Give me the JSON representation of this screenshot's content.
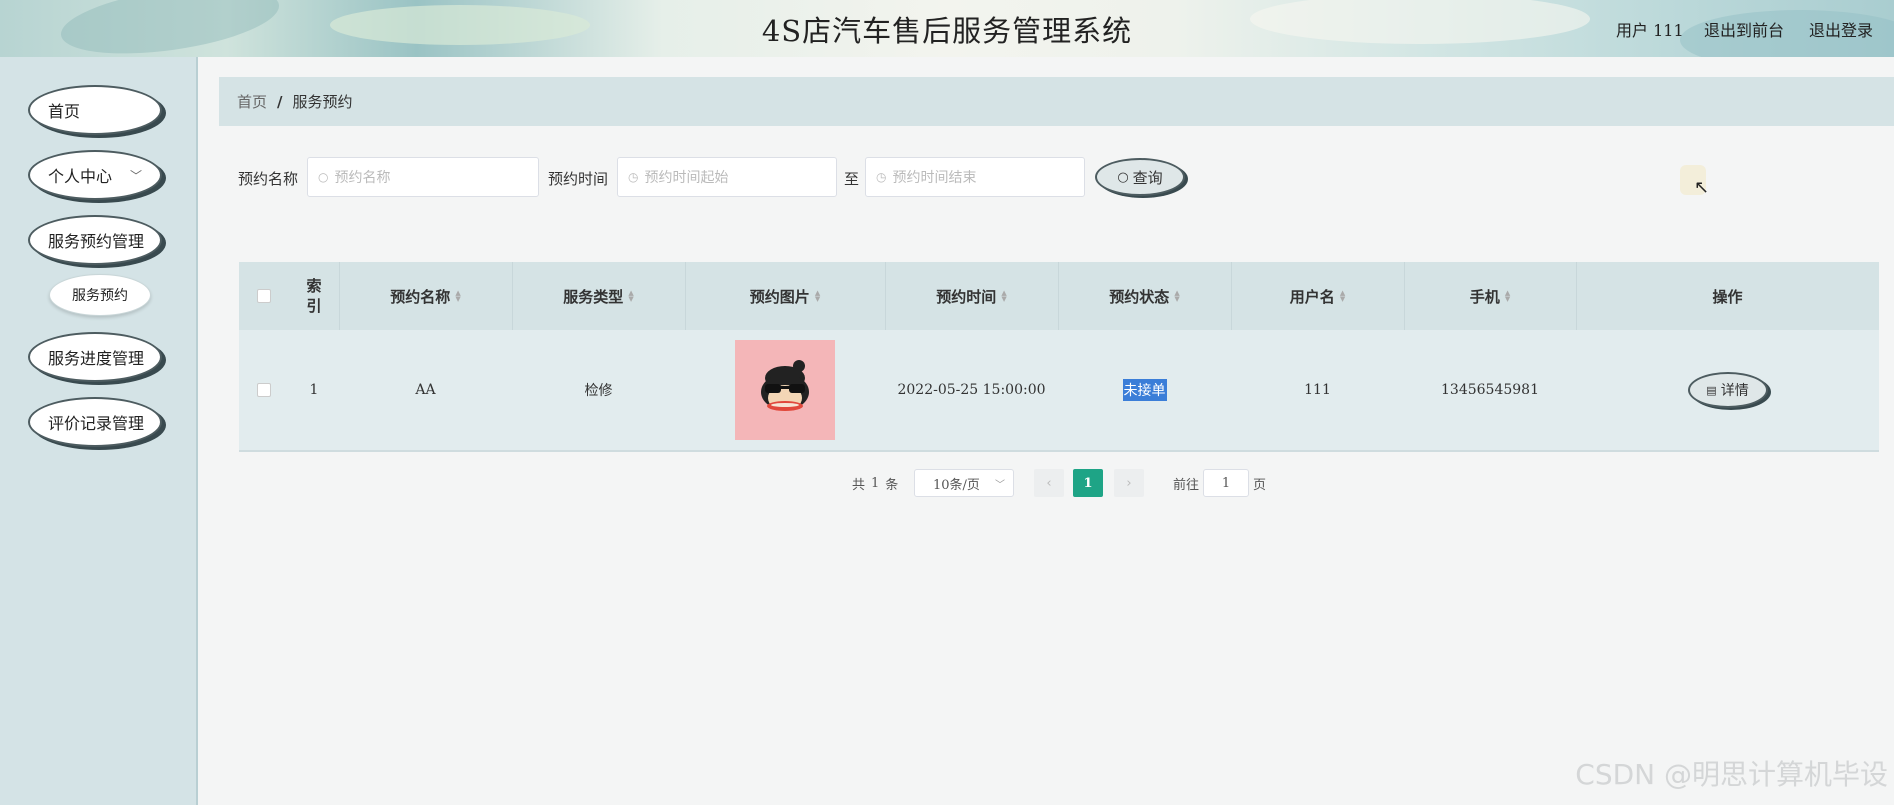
{
  "header": {
    "title": "4S店汽车售后服务管理系统",
    "user_label": "用户 111",
    "back_front": "退出到前台",
    "logout": "退出登录"
  },
  "sidebar": {
    "items": [
      {
        "label": "首页"
      },
      {
        "label": "个人中心",
        "chevron": "﹀"
      },
      {
        "label": "服务预约管理"
      },
      {
        "label": "服务进度管理"
      },
      {
        "label": "评价记录管理"
      }
    ],
    "sub_item": "服务预约"
  },
  "breadcrumb": {
    "home": "首页",
    "separator": "/",
    "current": "服务预约"
  },
  "search": {
    "name_label": "预约名称",
    "name_placeholder": "预约名称",
    "time_label": "预约时间",
    "time_start_placeholder": "预约时间起始",
    "to_label": "至",
    "time_end_placeholder": "预约时间结束",
    "query_button": "查询"
  },
  "table": {
    "headers": [
      "索引",
      "预约名称",
      "服务类型",
      "预约图片",
      "预约时间",
      "预约状态",
      "用户名",
      "手机",
      "操作"
    ],
    "index_header_lines": [
      "索",
      "引"
    ],
    "rows": [
      {
        "index": "1",
        "name": "AA",
        "service_type": "检修",
        "time": "2022-05-25 15:00:00",
        "status": "未接单",
        "username": "111",
        "phone": "13456545981",
        "action": "详情"
      }
    ]
  },
  "pagination": {
    "total_prefix": "共",
    "total_count": "1",
    "total_suffix": "条",
    "page_size": "10条/页",
    "current_page": "1",
    "goto_label": "前往",
    "goto_value": "1",
    "goto_suffix": "页"
  },
  "watermark": "CSDN @明思计算机毕设",
  "colors": {
    "sidebar_bg": "#d4e3e6",
    "accent_page": "#1ea486",
    "status_highlight": "#3b7ed8"
  }
}
